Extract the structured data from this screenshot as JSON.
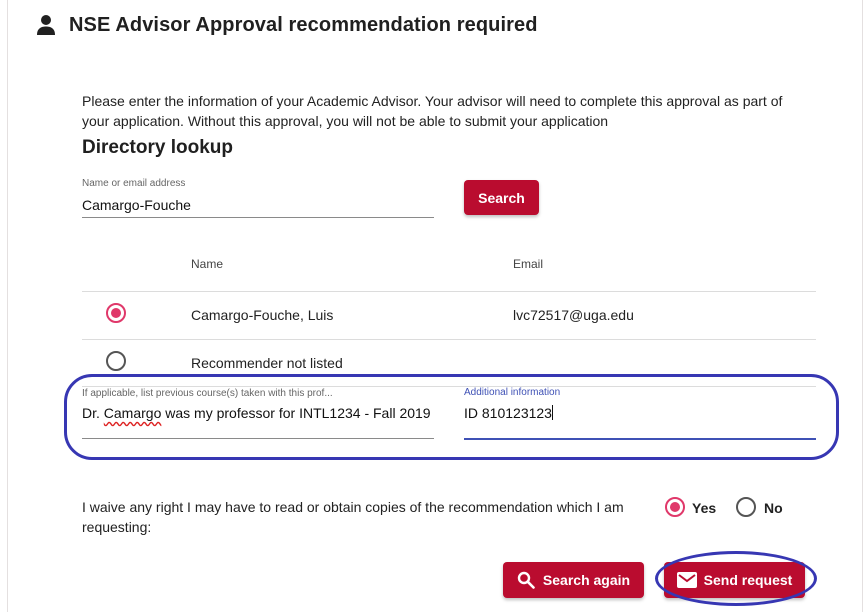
{
  "header": {
    "title": "NSE Advisor Approval recommendation required",
    "icon": "person-icon"
  },
  "intro": "Please enter the information of your Academic Advisor. Your advisor will need to complete this approval as part of your application. Without this approval, you will not be able to submit your application",
  "lookup": {
    "title": "Directory lookup",
    "label": "Name or email address",
    "value": "Camargo-Fouche",
    "search_label": "Search"
  },
  "table": {
    "columns": [
      "Name",
      "Email"
    ],
    "rows": [
      {
        "name": "Camargo-Fouche, Luis",
        "email": "lvc72517@uga.edu",
        "selected": true
      },
      {
        "name": "Recommender not listed",
        "email": "",
        "selected": false
      }
    ]
  },
  "courses": {
    "label": "If applicable, list previous course(s) taken with this prof...",
    "value_pre": "Dr. ",
    "value_misspelled": "Camargo",
    "value_post": " was my professor for INTL1234 - Fall 2019"
  },
  "additional": {
    "label": "Additional information",
    "value": "ID 810123123"
  },
  "waiver": {
    "text": "I waive any right I may have to read or obtain copies of the recommendation which I am requesting:",
    "yes": "Yes",
    "no": "No",
    "selected": "Yes"
  },
  "actions": {
    "search_again": "Search again",
    "send_request": "Send request"
  },
  "colors": {
    "accent": "#ba0c2f",
    "radio": "#e0386a",
    "annotation": "#3737b3",
    "focus": "#3f51b5"
  }
}
